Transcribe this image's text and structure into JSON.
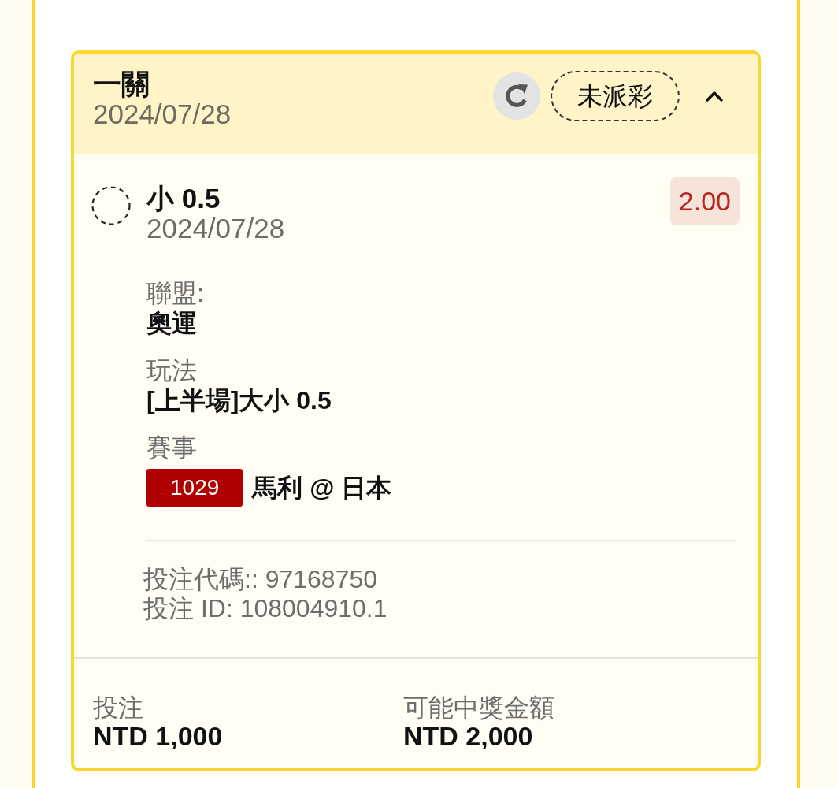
{
  "header": {
    "title": "一關",
    "date": "2024/07/28",
    "status": "未派彩",
    "expanded": true
  },
  "selection": {
    "name": "小 0.5",
    "date": "2024/07/28",
    "odds": "2.00",
    "details": [
      {
        "kind": "text",
        "label": "聯盟:",
        "value": "奧運"
      },
      {
        "kind": "text",
        "label": "玩法",
        "value": "[上半場]大小 0.5"
      },
      {
        "kind": "match",
        "label": "賽事",
        "code": "1029",
        "value": "馬利 @ 日本"
      }
    ],
    "references": [
      "投注代碼:: 97168750",
      "投注 ID: 108004910.1"
    ]
  },
  "summary": [
    {
      "label": "投注",
      "value": "NTD 1,000"
    },
    {
      "label": "可能中獎金額",
      "value": "NTD 2,000"
    }
  ]
}
